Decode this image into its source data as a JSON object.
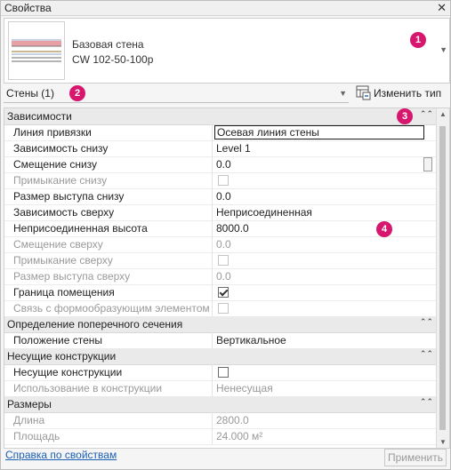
{
  "window": {
    "title": "Свойства",
    "close_icon": "close-icon"
  },
  "type_selector": {
    "line1": "Базовая стена",
    "line2": "CW 102-50-100p",
    "dropdown_icon": "chevron-down-icon",
    "badge": "1"
  },
  "filter": {
    "label": "Стены (1)",
    "dropdown_icon": "chevron-down-icon",
    "badge": "2"
  },
  "edit_type": {
    "label": "Изменить тип",
    "icon": "edit-type-icon"
  },
  "badges": {
    "b3": "3",
    "b4": "4"
  },
  "groups": {
    "constraints": {
      "label": "Зависимости",
      "toggle": "⌃"
    },
    "cross_section": {
      "label": "Определение поперечного сечения",
      "toggle": "⌃"
    },
    "structural": {
      "label": "Несущие конструкции",
      "toggle": "⌃"
    },
    "dimensions": {
      "label": "Размеры",
      "toggle": "⌃"
    }
  },
  "rows": [
    {
      "label": "Линия привязки",
      "value": "Осевая линия стены",
      "state": "editing"
    },
    {
      "label": "Зависимость снизу",
      "value": "Level 1",
      "state": "normal"
    },
    {
      "label": "Смещение снизу",
      "value": "0.0",
      "state": "normal"
    },
    {
      "label": "Примыкание снизу",
      "value": "",
      "state": "disabled-checkbox"
    },
    {
      "label": "Размер выступа снизу",
      "value": "0.0",
      "state": "normal"
    },
    {
      "label": "Зависимость сверху",
      "value": "Неприсоединенная",
      "state": "normal"
    },
    {
      "label": "Неприсоединенная высота",
      "value": "8000.0",
      "state": "normal"
    },
    {
      "label": "Смещение сверху",
      "value": "0.0",
      "state": "disabled"
    },
    {
      "label": "Примыкание сверху",
      "value": "",
      "state": "disabled-checkbox"
    },
    {
      "label": "Размер выступа сверху",
      "value": "0.0",
      "state": "disabled"
    },
    {
      "label": "Граница помещения",
      "value": "",
      "state": "checked"
    },
    {
      "label": "Связь с формообразующим элементом",
      "value": "",
      "state": "disabled-checkbox"
    },
    {
      "label": "Положение стены",
      "value": "Вертикальное",
      "state": "normal"
    },
    {
      "label": "Несущие конструкции",
      "value": "",
      "state": "checkbox"
    },
    {
      "label": "Использование в конструкции",
      "value": "Ненесущая",
      "state": "disabled"
    },
    {
      "label": "Длина",
      "value": "2800.0",
      "state": "disabled"
    },
    {
      "label": "Площадь",
      "value": "24.000 м²",
      "state": "disabled"
    }
  ],
  "footer": {
    "help_link": "Справка по свойствам",
    "apply_button": "Применить"
  },
  "colors": {
    "badge": "#d6176d",
    "link": "#1a5fb4",
    "group_bg": "#eaeaea"
  }
}
